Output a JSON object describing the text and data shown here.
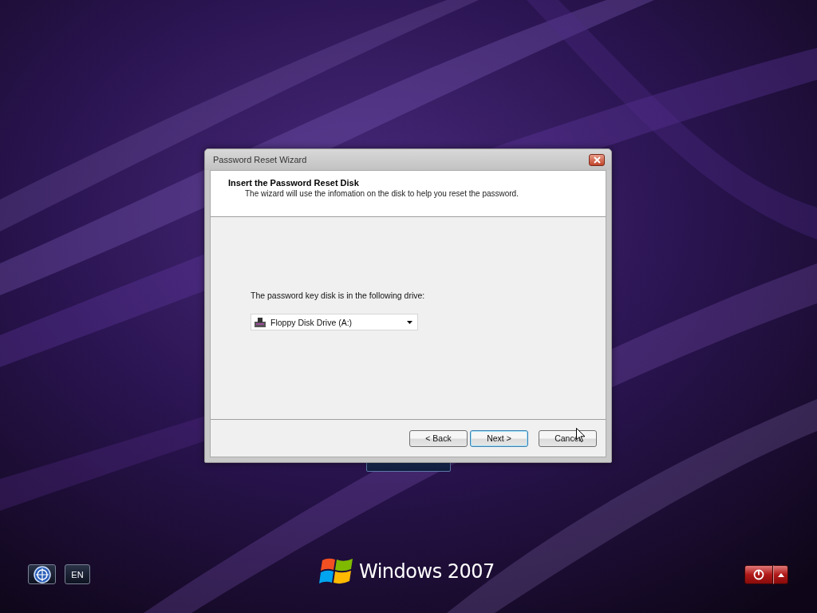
{
  "window": {
    "title": "Password Reset Wizard"
  },
  "header": {
    "title": "Insert the Password Reset Disk",
    "subtitle": "The wizard will use the infomation on the disk to help you reset the password."
  },
  "drive_prompt": "The password key disk is in the following drive:",
  "drive_select": {
    "value": "Floppy Disk Drive (A:)"
  },
  "buttons": [
    {
      "label": "< Back",
      "kind": "normal"
    },
    {
      "label": "Next >",
      "kind": "default"
    },
    {
      "label": "Cancel",
      "kind": "normal"
    }
  ],
  "taskbar": {
    "language": "EN",
    "logo_text": "Windows 2007"
  }
}
